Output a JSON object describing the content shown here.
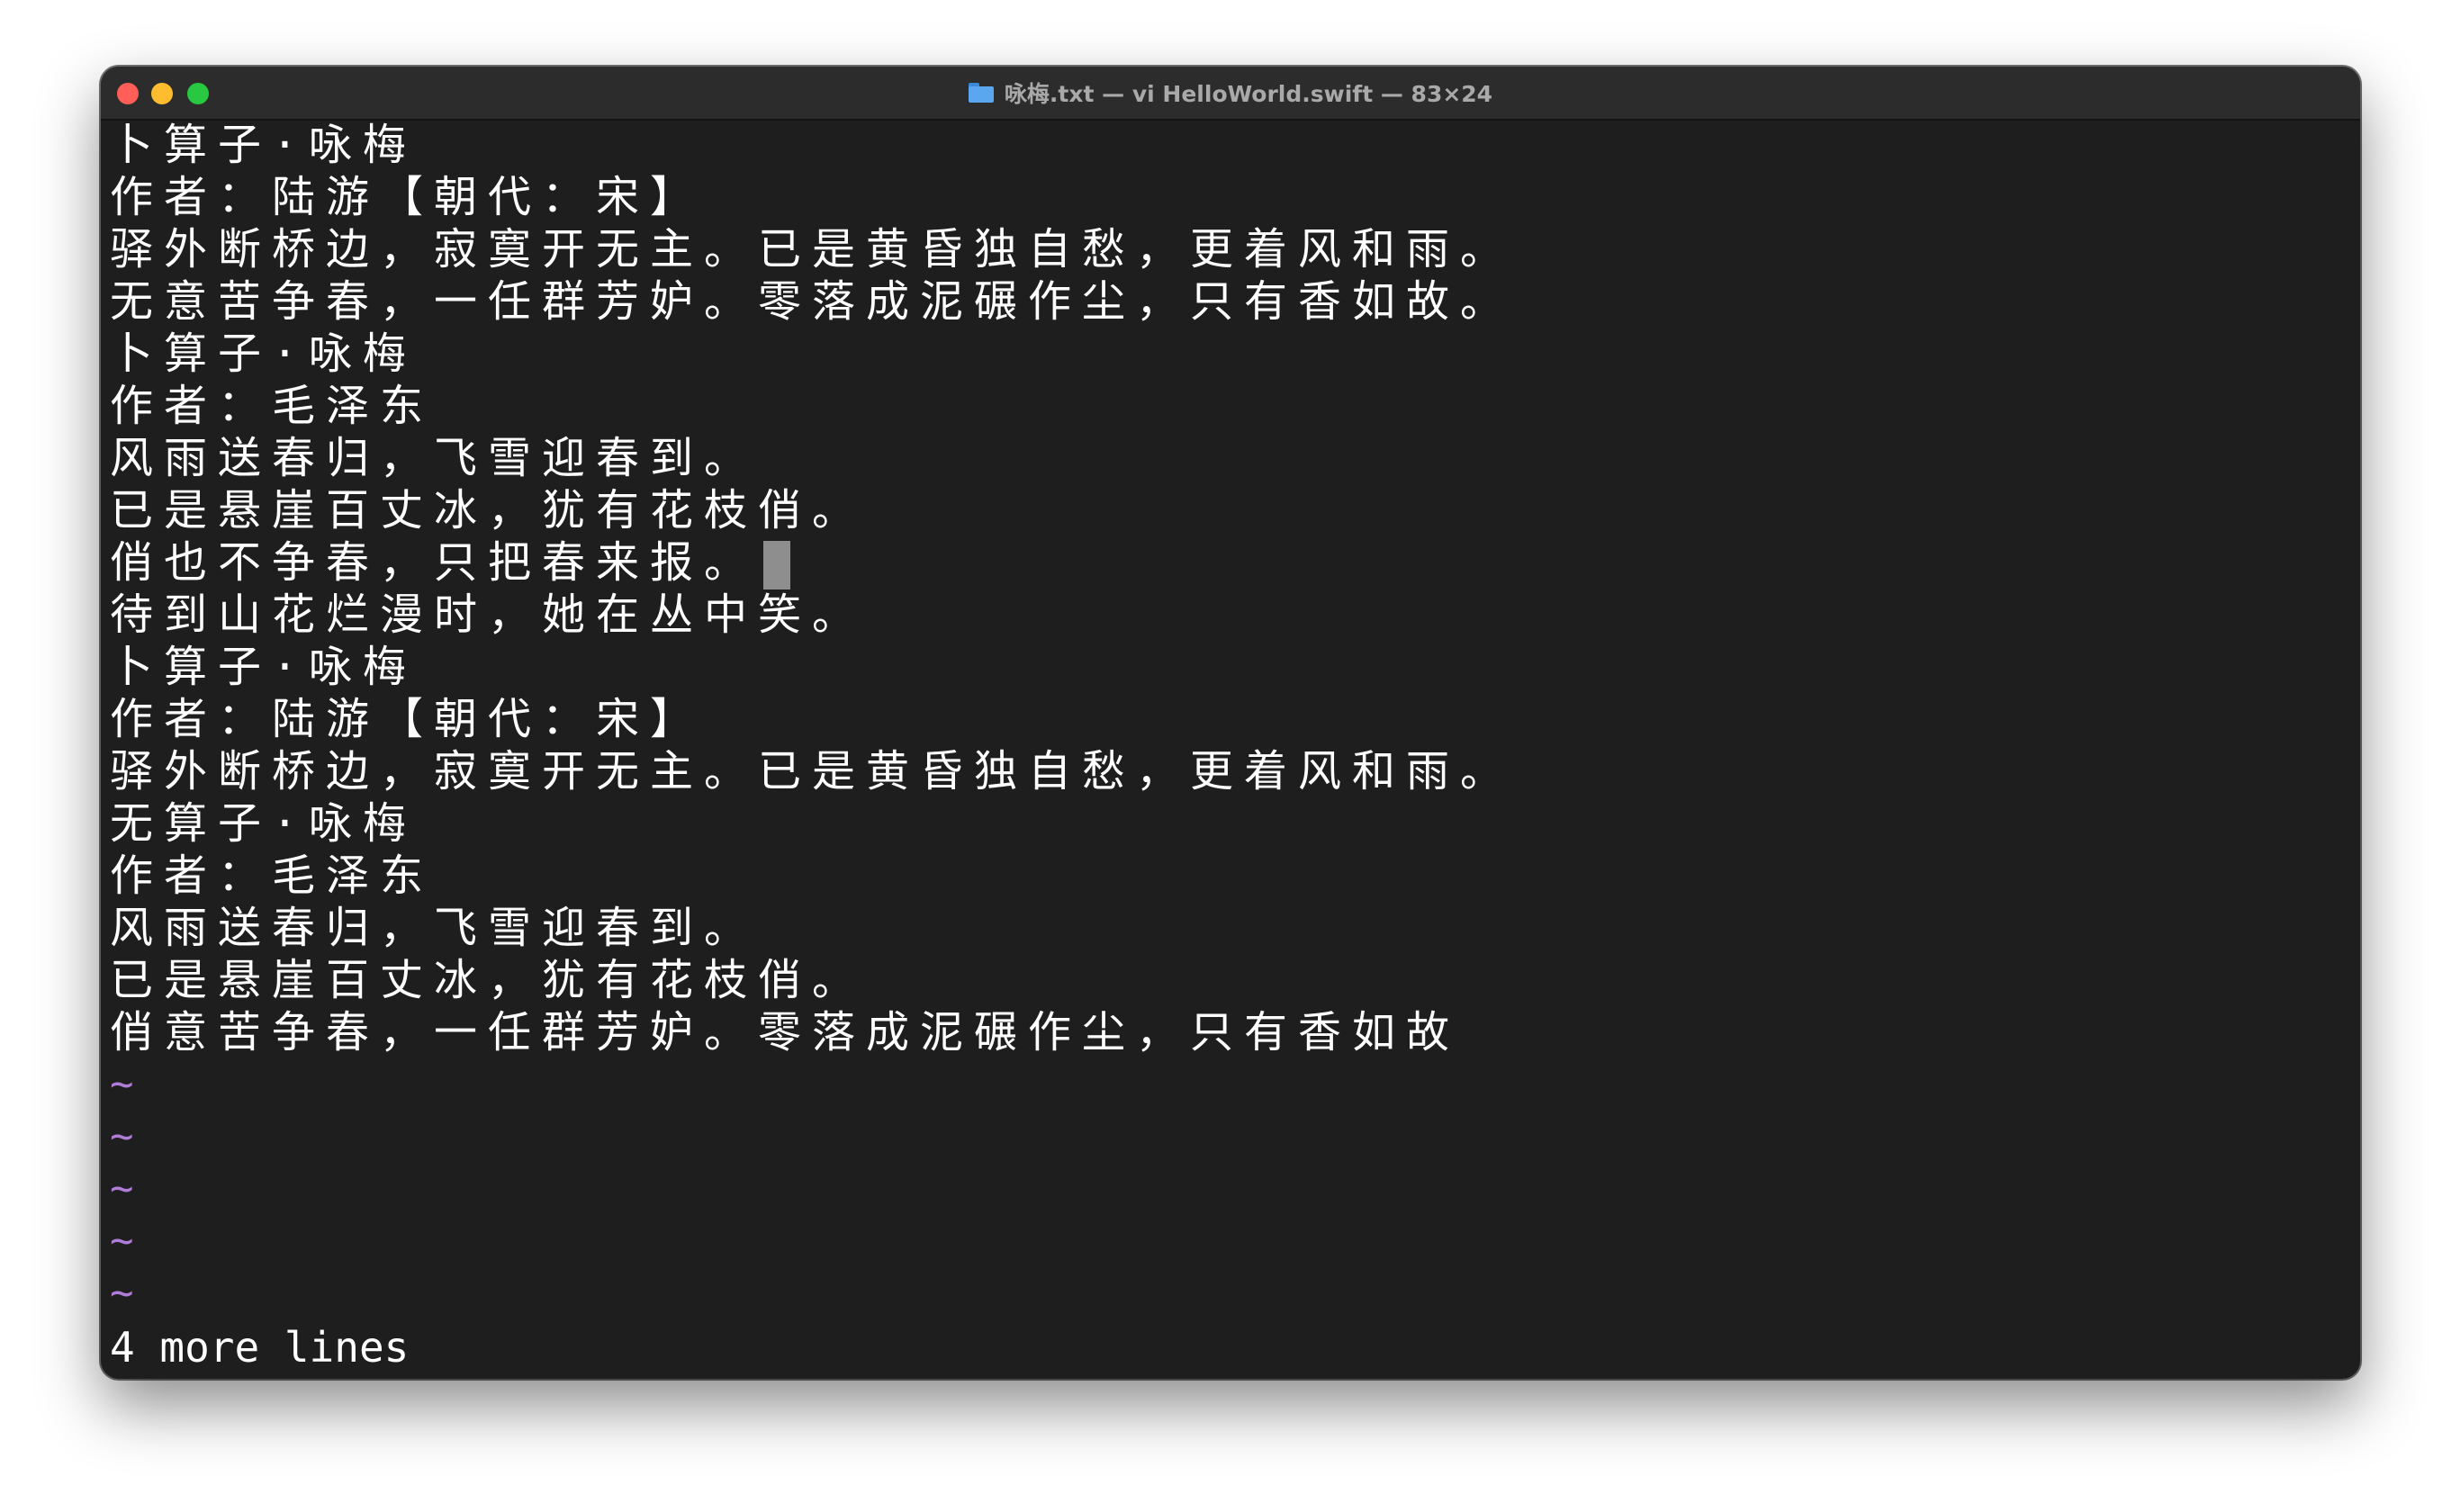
{
  "window": {
    "title": "咏梅.txt — vi HelloWorld.swift — 83×24",
    "title_icon": "folder-icon"
  },
  "editor": {
    "lines": [
      "卜算子·咏梅",
      "作者：陆游【朝代：宋】",
      "驿外断桥边，寂寞开无主。已是黄昏独自愁，更着风和雨。",
      "无意苦争春，一任群芳妒。零落成泥碾作尘，只有香如故。",
      "卜算子·咏梅",
      "作者：毛泽东",
      "风雨送春归，飞雪迎春到。",
      "已是悬崖百丈冰，犹有花枝俏。",
      "俏也不争春，只把春来报。",
      "待到山花烂漫时，她在丛中笑。",
      "卜算子·咏梅",
      "作者：陆游【朝代：宋】",
      "驿外断桥边，寂寞开无主。已是黄昏独自愁，更着风和雨。",
      "无算子·咏梅",
      "作者：毛泽东",
      "风雨送春归，飞雪迎春到。",
      "已是悬崖百丈冰，犹有花枝俏。",
      "俏意苦争春，一任群芳妒。零落成泥碾作尘，只有香如故"
    ],
    "empty_marker": "~",
    "cursor_line": 9,
    "status_message": "4 more lines"
  },
  "colors": {
    "background": "#1e1e1e",
    "titlebar": "#2c2c2c",
    "text": "#ffffff",
    "tilde": "#b07cd8",
    "cursor": "#8e8e8e"
  }
}
